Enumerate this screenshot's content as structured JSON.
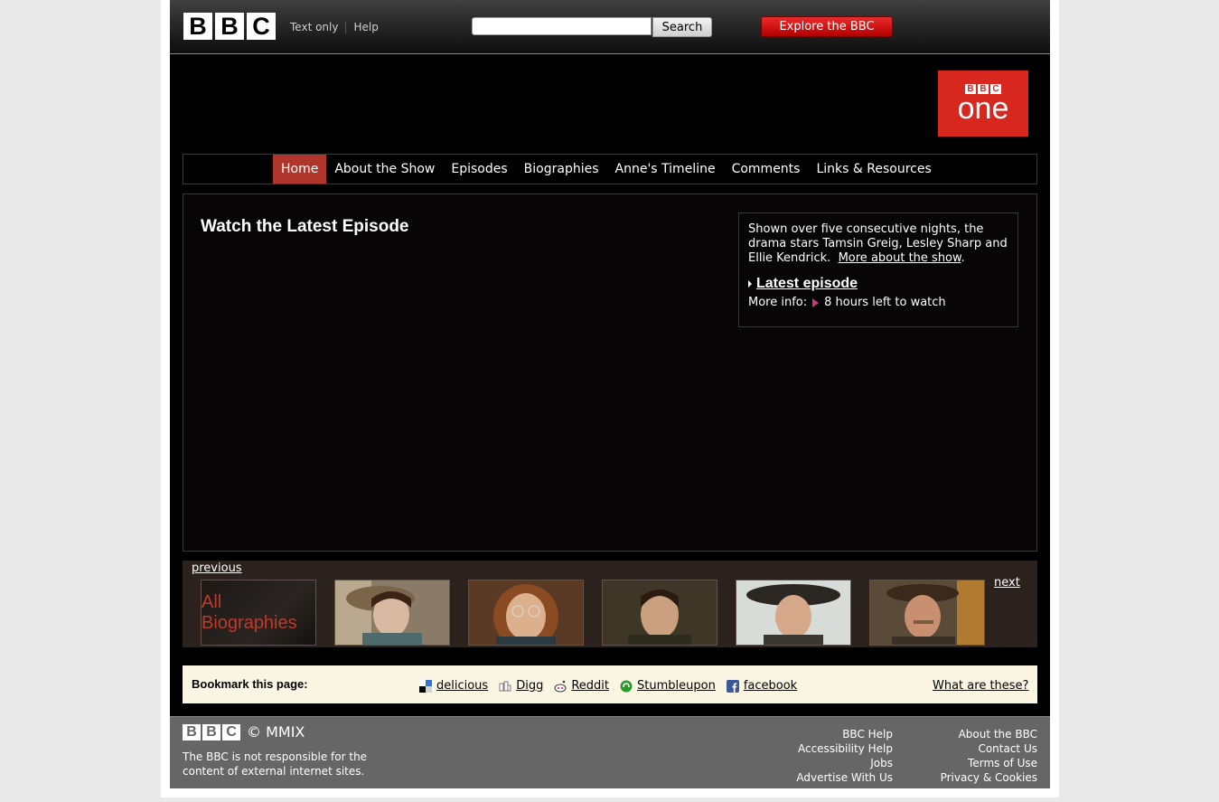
{
  "masthead": {
    "logo_letters": [
      "B",
      "B",
      "C"
    ],
    "links": [
      "Text only",
      "Help"
    ],
    "search": {
      "value": "",
      "placeholder": "",
      "button_label": "Search"
    },
    "explore_label": "Explore the BBC"
  },
  "channel_logo": {
    "letters": [
      "B",
      "B",
      "C"
    ],
    "word": "one",
    "color": "#d8271f"
  },
  "nav": {
    "active_index": 0,
    "items": [
      "Home",
      "About the Show",
      "Episodes",
      "Biographies",
      "Anne's Timeline",
      "Comments",
      "Links & Resources"
    ]
  },
  "main": {
    "heading": "Watch the Latest Episode",
    "info": {
      "description": "Shown over five consecutive nights, the drama stars Tamsin Greig, Lesley Sharp and Ellie Kendrick.",
      "more_link": "More about the show",
      "more_suffix": ".",
      "latest_label": "Latest episode",
      "more_info_label": "More info:",
      "availability": "8 hours left to watch"
    }
  },
  "carousel": {
    "previous_label": "previous",
    "next_label": "next",
    "first_tile_label": "All Biographies",
    "portrait_icons": [
      "portrait-girl-hat",
      "portrait-girl-glasses",
      "portrait-young-man",
      "portrait-woman-hat",
      "portrait-man-hat"
    ]
  },
  "bookmark": {
    "label": "Bookmark this page:",
    "services": [
      {
        "name": "delicious",
        "icon": "delicious-icon"
      },
      {
        "name": "Digg",
        "icon": "digg-icon"
      },
      {
        "name": "Reddit",
        "icon": "reddit-icon"
      },
      {
        "name": "Stumbleupon",
        "icon": "stumbleupon-icon"
      },
      {
        "name": "facebook",
        "icon": "facebook-icon"
      }
    ],
    "what_label": "What are these?"
  },
  "footer": {
    "logo_letters": [
      "B",
      "B",
      "C"
    ],
    "copyright": "© MMIX",
    "disclaimer": "The BBC is not responsible for the content of external internet sites.",
    "col1": [
      "BBC Help",
      "Accessibility Help",
      "Jobs",
      "Advertise With Us"
    ],
    "col2": [
      "About the BBC",
      "Contact Us",
      "Terms of Use",
      "Privacy & Cookies"
    ]
  }
}
